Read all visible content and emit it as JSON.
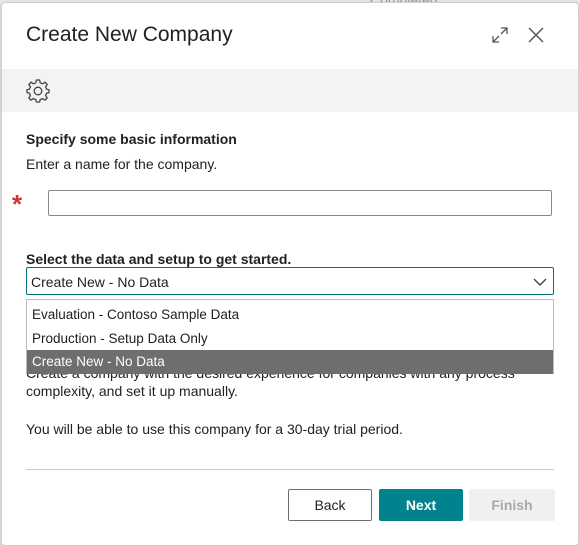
{
  "background": {
    "partial_text": "Completed"
  },
  "dialog": {
    "title": "Create New Company"
  },
  "form": {
    "heading": "Specify some basic information",
    "description": "Enter a name for the company.",
    "name_value": "",
    "name_placeholder": "",
    "required_marker": "*"
  },
  "data_select": {
    "heading": "Select the data and setup to get started.",
    "selected": "Create New - No Data",
    "options": [
      "Evaluation - Contoso Sample Data",
      "Production - Setup Data Only",
      "Create New - No Data"
    ]
  },
  "details": {
    "obscured_line": "Create a company with the desired experience for companies with any process",
    "line1": "complexity, and set it up manually.",
    "line2": "You will be able to use this company for a 30-day trial period."
  },
  "buttons": {
    "back": "Back",
    "next": "Next",
    "finish": "Finish"
  },
  "colors": {
    "accent": "#00838c",
    "required": "#d13438",
    "selected_option_bg": "#6e6e6e"
  }
}
